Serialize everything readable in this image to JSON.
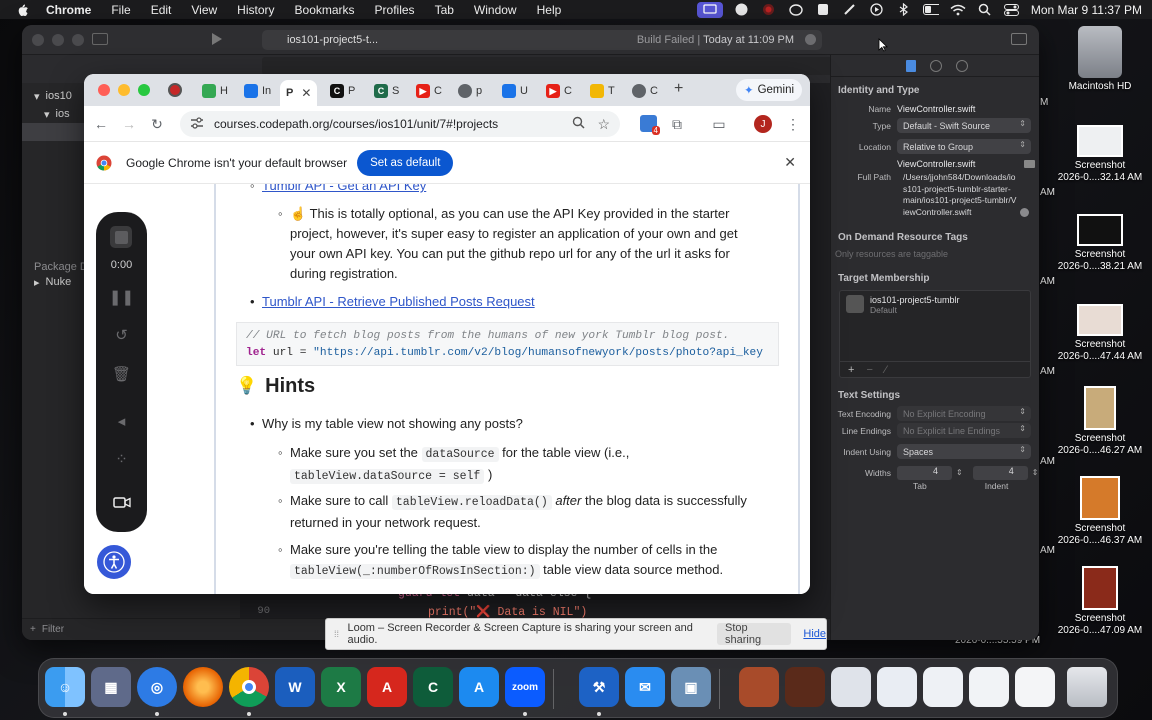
{
  "menubar": {
    "app": "Chrome",
    "items": [
      "File",
      "Edit",
      "View",
      "History",
      "Bookmarks",
      "Profiles",
      "Tab",
      "Window",
      "Help"
    ],
    "clock": "Mon Mar 9  11:37 PM"
  },
  "xcode": {
    "scheme_tab": "ios101-project5-t...",
    "build_status": "Build Failed",
    "build_time": "Today at 11:09 PM",
    "navigator": {
      "rows": [
        "ios10",
        "ios"
      ],
      "section_label": "Package D",
      "package_row": "Nuke",
      "filter_placeholder": "Filter"
    },
    "editor": {
      "lines": [
        {
          "num": "",
          "code_kw": "guard let",
          "code_rest": " data = data else {"
        },
        {
          "num": "90",
          "code_kw": "",
          "code_rest": "print(\"❌ Data is NIL\")"
        }
      ]
    },
    "inspector": {
      "identity_title": "Identity and Type",
      "name_label": "Name",
      "name_value": "ViewController.swift",
      "type_label": "Type",
      "type_value": "Default - Swift Source",
      "location_label": "Location",
      "location_value": "Relative to Group",
      "location_file": "ViewController.swift",
      "fullpath_label": "Full Path",
      "fullpath_value": "/Users/jjohn584/Downloads/ios101-project5-tumblr-starter-main/ios101-project5-tumblr/ViewController.swift",
      "on_demand_title": "On Demand Resource Tags",
      "on_demand_placeholder": "Only resources are taggable",
      "target_title": "Target Membership",
      "target_name": "ios101-project5-tumblr",
      "target_sub": "Default",
      "text_settings_title": "Text Settings",
      "encoding_label": "Text Encoding",
      "encoding_value": "No Explicit Encoding",
      "line_endings_label": "Line Endings",
      "line_endings_value": "No Explicit Line Endings",
      "indent_label": "Indent Using",
      "indent_value": "Spaces",
      "widths_label": "Widths",
      "tab_width": "4",
      "indent_width": "4",
      "tab_caption": "Tab",
      "indent_caption": "Indent"
    }
  },
  "chrome": {
    "tabs": [
      {
        "label": "H",
        "color": "#34a853",
        "letter": ""
      },
      {
        "label": "In",
        "color": "#1a73e8",
        "letter": "E"
      },
      {
        "label": "P",
        "color": "#222222",
        "letter": ""
      },
      {
        "label": "P",
        "color": "#111111",
        "letter": "C"
      },
      {
        "label": "S",
        "color": "#1f6b4a",
        "letter": "C"
      },
      {
        "label": "C",
        "color": "#e62117",
        "letter": "▶"
      },
      {
        "label": "p",
        "color": "#5f6368",
        "letter": ""
      },
      {
        "label": "U",
        "color": "#1a73e8",
        "letter": ""
      },
      {
        "label": "C",
        "color": "#e62117",
        "letter": "▶"
      },
      {
        "label": "T",
        "color": "#f2b705",
        "letter": ""
      },
      {
        "label": "C",
        "color": "#5f6368",
        "letter": ""
      }
    ],
    "gemini_label": "Gemini",
    "url": "courses.codepath.org/courses/ios101/unit/7#!projects",
    "profile_initial": "J",
    "extension_badge": "4",
    "infobar": {
      "message": "Google Chrome isn't your default browser",
      "button": "Set as default"
    },
    "page": {
      "link_top": "Tumblr API - Get an API Key",
      "optional_note": "This is totally optional, as you can use the API Key provided in the starter project, however, it's super easy to register an application of your own and get your own API key. You can put the github repo url for any of the url it asks for during registration.",
      "optional_emoji": "☝️",
      "link_retrieve": "Tumblr API - Retrieve Published Posts Request",
      "code_comment": "// URL to fetch blog posts from the humans of new york Tumblr blog post.",
      "code_kw": "let",
      "code_rest": " url = ",
      "code_string": "\"https://api.tumblr.com/v2/blog/humansofnewyork/posts/photo?api_key",
      "hints_emoji": "💡",
      "hints_title": "Hints",
      "question": "Why is my table view not showing any posts?",
      "tip1_pre": "Make sure you set the",
      "tip1_code": "dataSource",
      "tip1_post": "for the table view (i.e.,",
      "tip1_code2": "tableView.dataSource = self",
      "tip1_end": ")",
      "tip2_pre": "Make sure to call",
      "tip2_code": "tableView.reloadData()",
      "tip2_em": "after",
      "tip2_post": "the blog data is successfully returned in your network request.",
      "tip3_pre": "Make sure you're telling the table view to display the number of cells in the",
      "tip3_code": "tableView(_:numberOfRowsInSection:)",
      "tip3_post": "table view data source method."
    }
  },
  "loom": {
    "timer": "0:00",
    "share_message": "Loom – Screen Recorder & Screen Capture is sharing your screen and audio.",
    "stop_sharing": "Stop sharing",
    "hide": "Hide"
  },
  "desktop": {
    "hd_label": "Macintosh HD",
    "screenshots": [
      {
        "title": "Screenshot",
        "sub": "2026-0....32.14 AM"
      },
      {
        "title": "Screenshot",
        "sub": "2026-0....38.21 AM"
      },
      {
        "title": "Screenshot",
        "sub": "2026-0....47.44 AM"
      },
      {
        "title": "Screenshot",
        "sub": "2026-0....46.27 AM"
      },
      {
        "title": "Screenshot",
        "sub": "2026-0....46.37 AM"
      },
      {
        "title": "Screenshot",
        "sub": "2026-0....47.09 AM"
      }
    ],
    "partial_labels": [
      "M",
      "AM",
      "AM",
      "AM",
      "AM",
      "AM",
      "2026-0....55.59 PM"
    ]
  },
  "dock": {
    "apps": [
      {
        "name": "Finder",
        "color": "#1e88e5",
        "glyph": "☺"
      },
      {
        "name": "Launchpad",
        "color": "#5f6a8a",
        "glyph": "▦"
      },
      {
        "name": "Safari",
        "color": "#2d7be5",
        "glyph": "◎"
      },
      {
        "name": "Firefox",
        "color": "#e66000",
        "glyph": "🦊"
      },
      {
        "name": "Chrome",
        "color": "#ffffff",
        "glyph": "◉"
      },
      {
        "name": "Word",
        "color": "#1b5ebe",
        "glyph": "W"
      },
      {
        "name": "Excel",
        "color": "#1d7a45",
        "glyph": "X"
      },
      {
        "name": "Acrobat",
        "color": "#d6271d",
        "glyph": "A"
      },
      {
        "name": "Cursor",
        "color": "#0e5c3a",
        "glyph": "C"
      },
      {
        "name": "App Store",
        "color": "#1c8af0",
        "glyph": "A"
      },
      {
        "name": "Zoom",
        "color": "#0b5cff",
        "glyph": "zoom"
      },
      {
        "name": "Xcode",
        "color": "#1d62c5",
        "glyph": "⚒"
      },
      {
        "name": "Messages",
        "color": "#2a8cf0",
        "glyph": "✉"
      },
      {
        "name": "Preview",
        "color": "#6a8fb5",
        "glyph": "▣"
      }
    ],
    "right_items": [
      "Downloads",
      "Folder1",
      "Folder2",
      "Folder3",
      "Folder4",
      "Folder5",
      "Folder6",
      "Trash"
    ]
  }
}
